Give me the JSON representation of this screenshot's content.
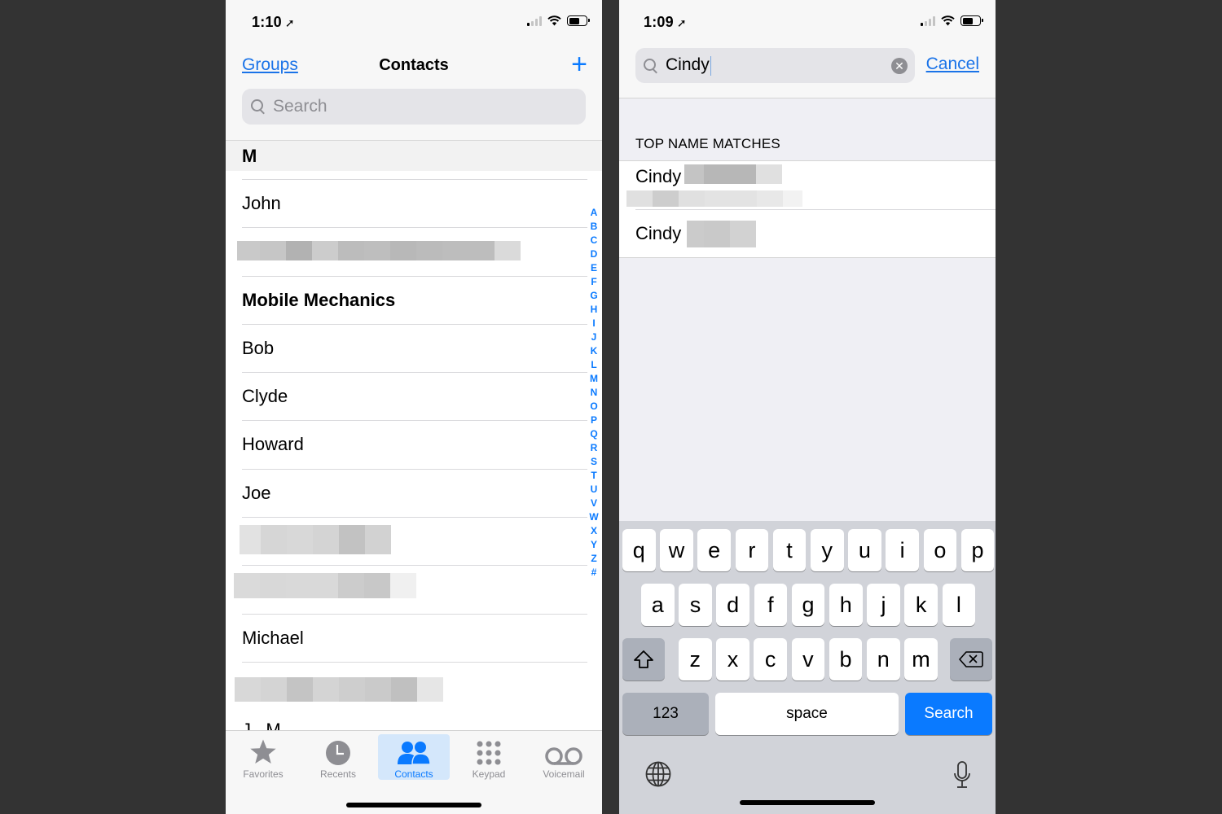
{
  "left": {
    "status": {
      "time": "1:10",
      "location_icon": "location-arrow-outline"
    },
    "nav": {
      "left_label": "Groups",
      "title": "Contacts",
      "add_icon": "plus-icon"
    },
    "search": {
      "placeholder": "Search"
    },
    "section": "M",
    "contacts": [
      {
        "name": "John",
        "bold": false
      },
      {
        "name": "",
        "redacted": true
      },
      {
        "name": "Mobile Mechanics",
        "bold": true
      },
      {
        "name": "Bob",
        "bold": false
      },
      {
        "name": "Clyde",
        "bold": false
      },
      {
        "name": "Howard",
        "bold": false
      },
      {
        "name": "Joe",
        "bold": false
      },
      {
        "name": "",
        "redacted": true
      },
      {
        "name": "",
        "redacted": true
      },
      {
        "name": "Michael",
        "bold": false
      },
      {
        "name": "",
        "redacted": true
      }
    ],
    "partial_row": "J.. M..",
    "index_letters": [
      "A",
      "B",
      "C",
      "D",
      "E",
      "F",
      "G",
      "H",
      "I",
      "J",
      "K",
      "L",
      "M",
      "N",
      "O",
      "P",
      "Q",
      "R",
      "S",
      "T",
      "U",
      "V",
      "W",
      "X",
      "Y",
      "Z",
      "#"
    ],
    "tabs": [
      {
        "label": "Favorites",
        "icon": "star-icon",
        "active": false
      },
      {
        "label": "Recents",
        "icon": "clock-icon",
        "active": false
      },
      {
        "label": "Contacts",
        "icon": "contacts-icon",
        "active": true
      },
      {
        "label": "Keypad",
        "icon": "keypad-icon",
        "active": false
      },
      {
        "label": "Voicemail",
        "icon": "voicemail-icon",
        "active": false
      }
    ],
    "accent": "#0a7aff"
  },
  "right": {
    "status": {
      "time": "1:09",
      "location_icon": "location-arrow-filled"
    },
    "search": {
      "value": "Cindy"
    },
    "cancel_label": "Cancel",
    "section_label": "TOP NAME MATCHES",
    "matches": [
      {
        "name": "Cindy",
        "redacted_surname": true,
        "redacted_detail": true
      },
      {
        "name": "Cindy",
        "redacted_surname": true,
        "redacted_detail": false
      }
    ],
    "keyboard": {
      "row1": [
        "q",
        "w",
        "e",
        "r",
        "t",
        "y",
        "u",
        "i",
        "o",
        "p"
      ],
      "row2": [
        "a",
        "s",
        "d",
        "f",
        "g",
        "h",
        "j",
        "k",
        "l"
      ],
      "row3": [
        "z",
        "x",
        "c",
        "v",
        "b",
        "n",
        "m"
      ],
      "numbers_label": "123",
      "space_label": "space",
      "action_label": "Search"
    }
  }
}
